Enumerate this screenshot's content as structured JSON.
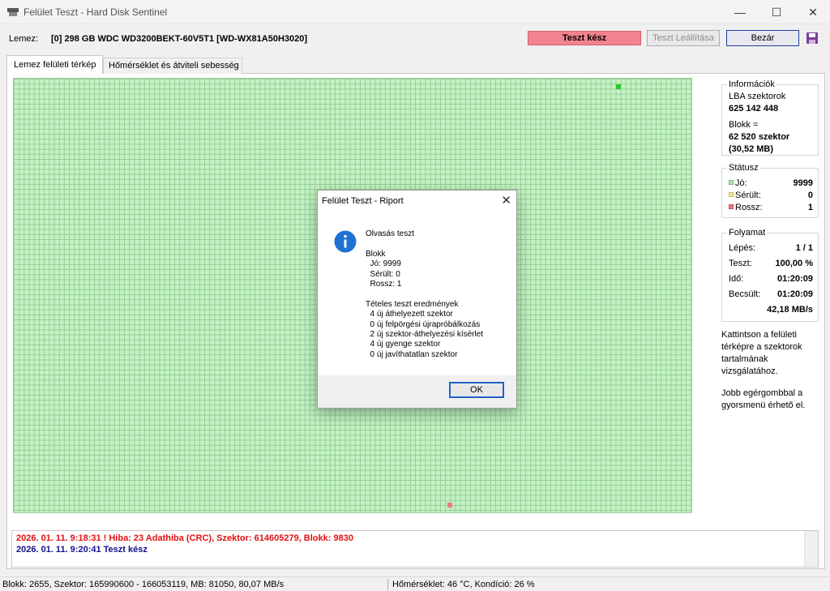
{
  "window": {
    "title": "Felület Teszt - Hard Disk Sentinel",
    "controls": {
      "minimize": "—",
      "maximize": "☐",
      "close": "✕"
    }
  },
  "disk": {
    "label": "Lemez:",
    "value": "[0] 298 GB  WDC WD3200BEKT-60V5T1 [WD-WX81A50H3020]"
  },
  "toolbar": {
    "status": "Teszt kész",
    "stop_label": "Teszt Leállítása",
    "close_label": "Bezár",
    "status_color": "#f2838e"
  },
  "tabs": [
    {
      "label": "Lemez felületi térkép",
      "active": true
    },
    {
      "label": "Hőmérséklet és átviteli sebesség",
      "active": false
    }
  ],
  "info": {
    "title": "Információk",
    "lba_label": "LBA szektorok",
    "lba_value": "625 142 448",
    "block_label": "Blokk =",
    "block_sectors": "62 520 szektor",
    "block_mb": "(30,52 MB)"
  },
  "status": {
    "title": "Státusz",
    "good_label": "Jó:",
    "good_value": "9999",
    "damaged_label": "Sérült:",
    "damaged_value": "0",
    "bad_label": "Rossz:",
    "bad_value": "1",
    "colors": {
      "good": "#a8e8a8",
      "damaged": "#f0e890",
      "bad": "#f07a8a"
    }
  },
  "progress": {
    "title": "Folyamat",
    "step_label": "Lépés:",
    "step_value": "1 / 1",
    "test_label": "Teszt:",
    "test_value": "100,00 %",
    "time_label": "Idő:",
    "time_value": "01:20:09",
    "est_label": "Becsült:",
    "est_value": "01:20:09",
    "speed": "42,18 MB/s"
  },
  "help": {
    "text1": "Kattintson a felületi térképre a szektorok tartalmának vizsgálatához.",
    "text2": "Jobb egérgombbal a gyorsmenü érhető el."
  },
  "log": {
    "line1": "2026. 01. 11.  9:18:31 ! Hiba: 23 Adathiba (CRC), Szektor: 614605279, Blokk: 9830",
    "line2": "2026. 01. 11.  9:20:41   Teszt kész"
  },
  "statusbar": {
    "left": "Blokk: 2655, Szektor: 165990600 - 166053119, MB: 81050, 80,07 MB/s",
    "right": "Hőmérséklet: 46  °C,  Kondíció: 26 %"
  },
  "dialog": {
    "title": "Felület Teszt - Riport",
    "close": "✕",
    "body": "Olvasás teszt\n\nBlokk\n  Jó: 9999\n  Sérült: 0\n  Rossz: 1\n\nTételes teszt eredmények\n  4 új áthelyezett szektor\n  0 új felpörgési újrapróbálkozás\n  2 új szektor-áthelyezési kísérlet\n  4 új gyenge szektor\n  0 új javíthatatlan szektor",
    "ok_label": "OK"
  }
}
